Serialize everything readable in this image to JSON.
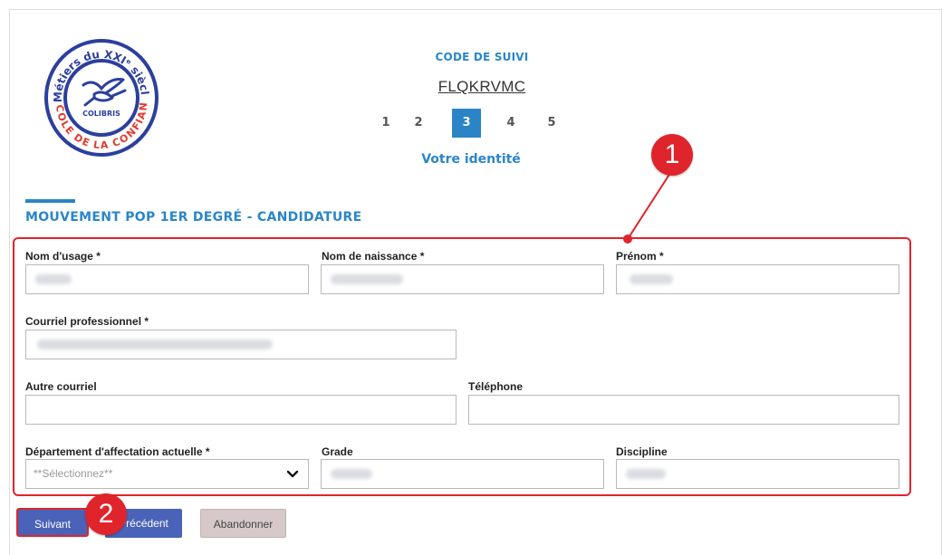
{
  "logo": {
    "ring_text_top": "Métiers du XXIᵉ siècle",
    "center_text": "COLIBRIS",
    "ring_text_bottom": "L'ÉCOLE DE LA CONFIANCE"
  },
  "header": {
    "code_label": "CODE DE SUIVI",
    "code_value": "FLQKRVMC",
    "steps": [
      "1",
      "2",
      "3",
      "4",
      "5"
    ],
    "active_step": "3",
    "step_title": "Votre identité"
  },
  "section": {
    "title": "MOUVEMENT POP 1ER DEGRÉ - CANDIDATURE"
  },
  "form": {
    "required_mark": "*",
    "nom_usage_label": "Nom d'usage",
    "nom_naissance_label": "Nom de naissance",
    "prenom_label": "Prénom",
    "courriel_pro_label": "Courriel professionnel",
    "autre_courriel_label": "Autre courriel",
    "telephone_label": "Téléphone",
    "departement_label": "Département d'affectation actuelle",
    "departement_placeholder": "**Sélectionnez**",
    "grade_label": "Grade",
    "discipline_label": "Discipline"
  },
  "buttons": {
    "next": "Suivant",
    "prev": "Précédent",
    "abandon": "Abandonner"
  },
  "annotations": {
    "badge1": "1",
    "badge2": "2"
  },
  "colors": {
    "accent_blue": "#2b84c6",
    "button_blue": "#4a63b8",
    "annotation_red": "#e0242c"
  }
}
